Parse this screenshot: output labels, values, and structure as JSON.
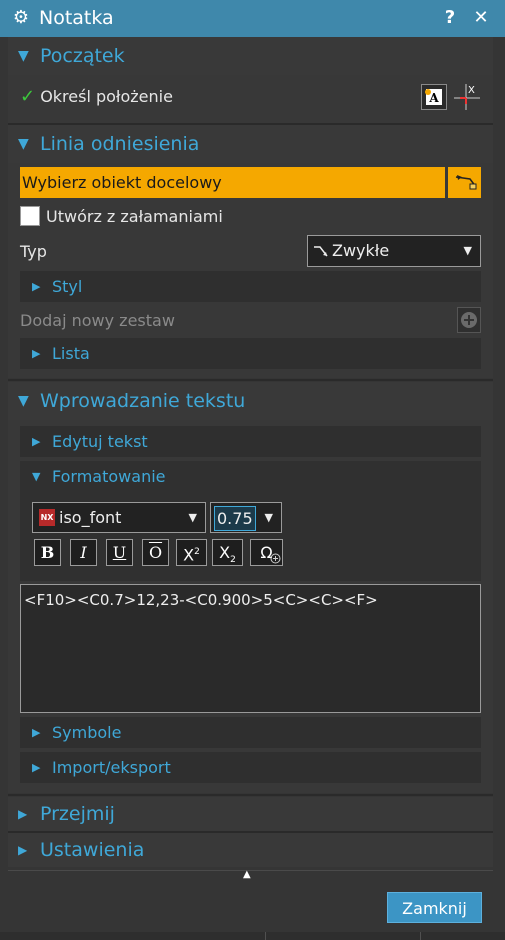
{
  "window": {
    "title": "Notatka",
    "gear_icon": "⚙",
    "help_label": "?",
    "close_label": "✕"
  },
  "sections": {
    "start": {
      "label": "Początek",
      "locate_check": "✓",
      "locate_label": "Określ położenie"
    },
    "leader": {
      "label": "Linia odniesienia",
      "select_target": "Wybierz obiekt docelowy",
      "create_with_jogs": "Utwórz z załamaniami",
      "type_label": "Typ",
      "type_value": "Zwykłe",
      "style_label": "Styl",
      "add_set_label": "Dodaj nowy zestaw",
      "list_label": "Lista"
    },
    "text_input": {
      "label": "Wprowadzanie tekstu",
      "edit_text": "Edytuj tekst",
      "formatting": "Formatowanie",
      "font_badge": "NX",
      "font_name": "iso_font",
      "font_scale": "0.75",
      "bold": "B",
      "italic": "I",
      "underline": "U",
      "overline": "O",
      "superscript_base": "X",
      "superscript_exp": "2",
      "subscript_base": "X",
      "subscript_exp": "2",
      "symbol": "Ω",
      "text_value": "<F10><C0.7>12,23-<C0.900>5<C><C><F>",
      "symbols": "Symbole",
      "import_export": "Import/eksport"
    },
    "inherit": {
      "label": "Przejmij"
    },
    "settings": {
      "label": "Ustawienia"
    }
  },
  "footer": {
    "collapse_glyph": "▲",
    "close_button": "Zamknij"
  },
  "colors": {
    "accent": "#3fa8d8",
    "titlebar": "#3f88ab",
    "highlight": "#f5a800",
    "close_button": "#3c95c5"
  }
}
